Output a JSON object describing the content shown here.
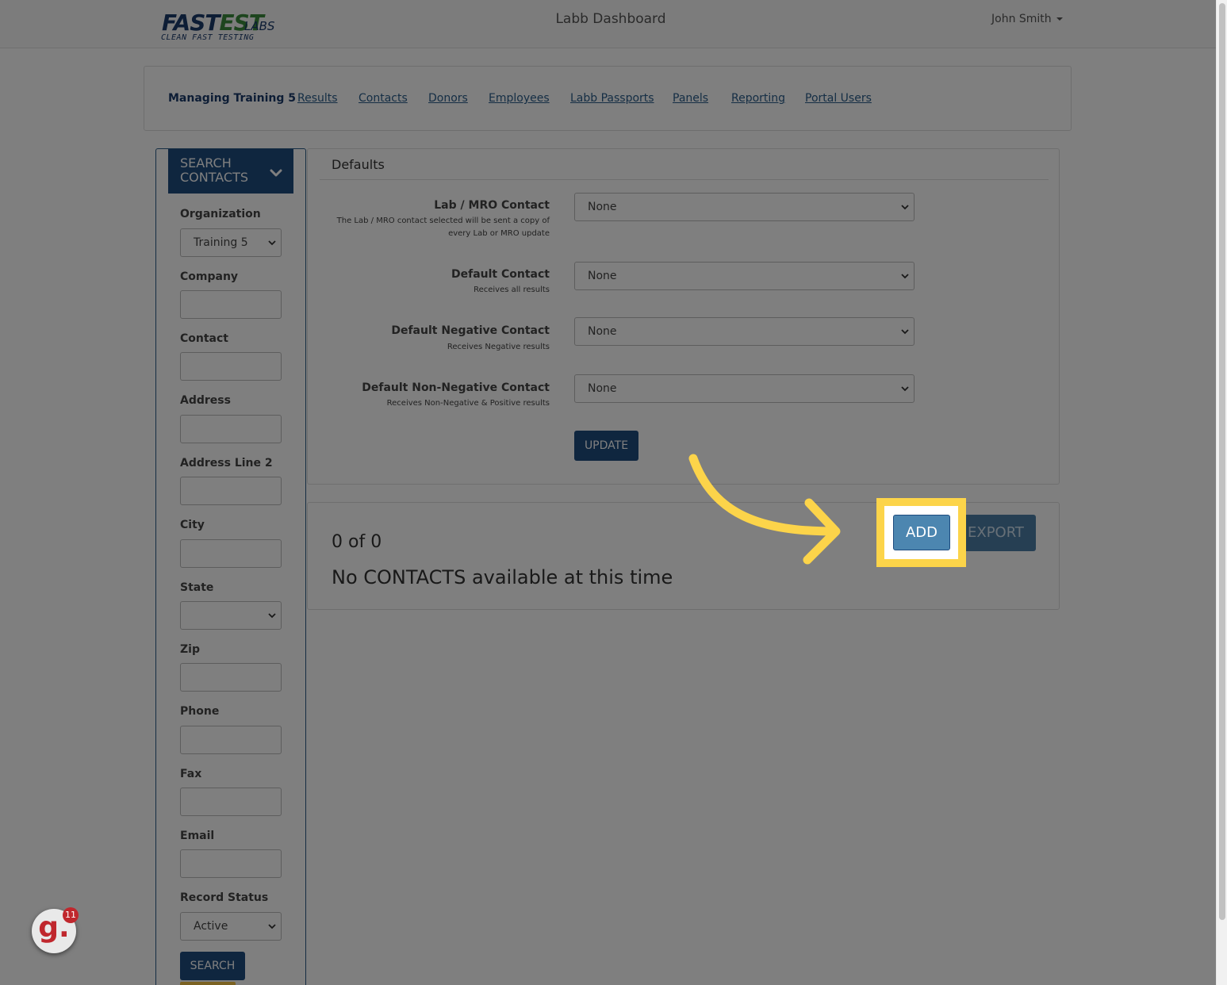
{
  "header": {
    "logo_word_1": "FAST",
    "logo_word_2": "EST",
    "logo_suffix": "LABS",
    "logo_tagline": "CLEAN FAST TESTING",
    "title": "Labb Dashboard",
    "user_name": "John Smith"
  },
  "nav": {
    "items": [
      {
        "label": "Managing Training 5"
      },
      {
        "label": "Results"
      },
      {
        "label": "Contacts"
      },
      {
        "label": "Donors"
      },
      {
        "label": "Employees"
      },
      {
        "label": "Labb Passports"
      },
      {
        "label": "Panels"
      },
      {
        "label": "Reporting"
      },
      {
        "label": "Portal Users"
      }
    ]
  },
  "sidebar": {
    "heading_line1": "SEARCH",
    "heading_line2": "CONTACTS",
    "fields": {
      "organization": {
        "label": "Organization",
        "value": "Training 5"
      },
      "company": {
        "label": "Company",
        "value": ""
      },
      "contact": {
        "label": "Contact",
        "value": ""
      },
      "address": {
        "label": "Address",
        "value": ""
      },
      "address2": {
        "label": "Address Line 2",
        "value": ""
      },
      "city": {
        "label": "City",
        "value": ""
      },
      "state": {
        "label": "State",
        "value": ""
      },
      "zip": {
        "label": "Zip",
        "value": ""
      },
      "phone": {
        "label": "Phone",
        "value": ""
      },
      "fax": {
        "label": "Fax",
        "value": ""
      },
      "email": {
        "label": "Email",
        "value": ""
      },
      "record_status": {
        "label": "Record Status",
        "value": "Active"
      }
    },
    "search_label": "SEARCH"
  },
  "defaults": {
    "title": "Defaults",
    "rows": [
      {
        "label": "Lab / MRO Contact",
        "help": "The Lab / MRO contact selected will be sent a copy of every Lab or MRO update",
        "value": "None"
      },
      {
        "label": "Default Contact",
        "help": "Receives all results",
        "value": "None"
      },
      {
        "label": "Default Negative Contact",
        "help": "Receives Negative results",
        "value": "None"
      },
      {
        "label": "Default Non-Negative Contact",
        "help": "Receives Non-Negative & Positive results",
        "value": "None"
      }
    ],
    "update_label": "UPDATE"
  },
  "results": {
    "count_text": "0 of 0",
    "empty_text": "No CONTACTS available at this time",
    "add_label": "ADD",
    "export_label": "EXPORT"
  },
  "guide_badge": {
    "letter": "g.",
    "count": "11"
  },
  "colors": {
    "primary": "#1e4c7f",
    "add_button": "#4c86b0",
    "highlight": "#fcd44a",
    "badge_red": "#c0272d"
  }
}
